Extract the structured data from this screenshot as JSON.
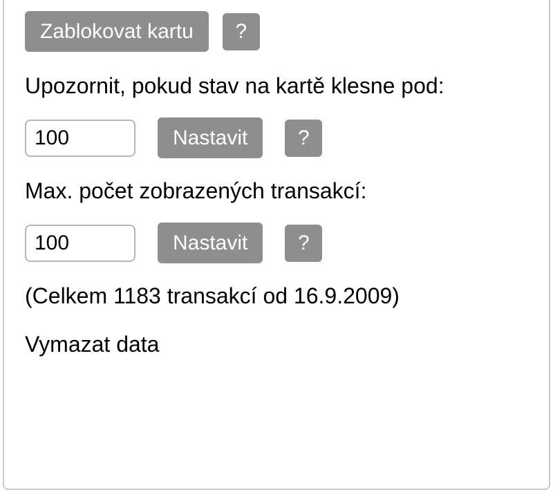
{
  "block_card": {
    "button_label": "Zablokovat kartu",
    "help_label": "?"
  },
  "alert_threshold": {
    "label": "Upozornit, pokud stav na kartě klesne pod:",
    "value": "100",
    "set_button_label": "Nastavit",
    "help_label": "?"
  },
  "max_transactions": {
    "label": "Max. počet zobrazených transakcí:",
    "value": "100",
    "set_button_label": "Nastavit",
    "help_label": "?"
  },
  "summary": "(Celkem 1183 transakcí od 16.9.2009)",
  "delete_data_label": "Vymazat data"
}
